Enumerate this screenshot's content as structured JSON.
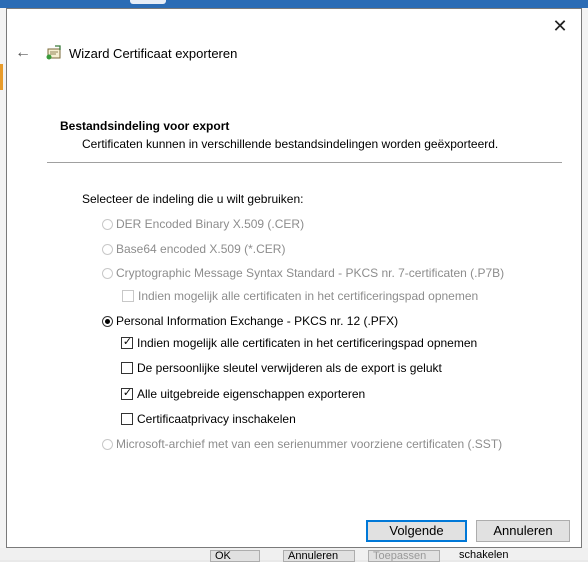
{
  "dialog": {
    "title": "Wizard Certificaat exporteren",
    "close_glyph": "✕",
    "back_glyph": "←",
    "heading": "Bestandsindeling voor export",
    "subheading": "Certificaten kunnen in verschillende bestandsindelingen worden geëxporteerd.",
    "prompt": "Selecteer de indeling die u wilt gebruiken:"
  },
  "options": {
    "der": {
      "label": "DER Encoded Binary X.509 (.CER)",
      "selected": false,
      "enabled": false
    },
    "base64": {
      "label": "Base64 encoded X.509 (*.CER)",
      "selected": false,
      "enabled": false
    },
    "pkcs7": {
      "label": "Cryptographic Message Syntax Standard - PKCS nr. 7-certificaten (.P7B)",
      "selected": false,
      "enabled": false
    },
    "pkcs7_include_path": {
      "label": "Indien mogelijk alle certificaten in het certificeringspad opnemen",
      "checked": false,
      "enabled": false
    },
    "pfx": {
      "label": "Personal Information Exchange - PKCS nr. 12 (.PFX)",
      "selected": true,
      "enabled": true
    },
    "pfx_include_path": {
      "label": "Indien mogelijk alle certificaten in het certificeringspad opnemen",
      "checked": true,
      "enabled": true
    },
    "pfx_delete_key": {
      "label": "De persoonlijke sleutel verwijderen als de export is gelukt",
      "checked": false,
      "enabled": true
    },
    "pfx_export_props": {
      "label": "Alle uitgebreide eigenschappen exporteren",
      "checked": true,
      "enabled": true
    },
    "pfx_privacy": {
      "label": "Certificaatprivacy inschakelen",
      "checked": false,
      "enabled": true
    },
    "sst": {
      "label": "Microsoft-archief met van een serienummer voorziene certificaten (.SST)",
      "selected": false,
      "enabled": false
    }
  },
  "buttons": {
    "next": "Volgende",
    "cancel": "Annuleren"
  },
  "background": {
    "bottom_buttons": [
      "OK",
      "Annuleren",
      "Toepassen",
      "schakelen"
    ]
  },
  "check_glyph": "✓"
}
